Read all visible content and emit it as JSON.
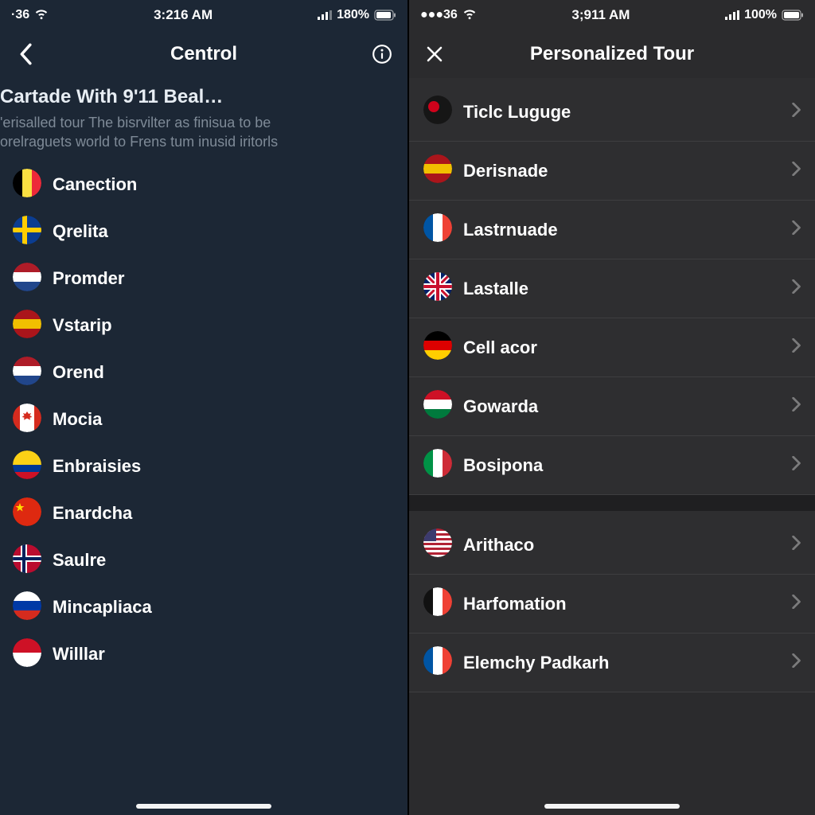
{
  "left": {
    "status": {
      "carrier": "·36",
      "time": "3:216 AM",
      "battery": "180%"
    },
    "title": "Centrol",
    "hero": {
      "heading": "Cartade With 9'11 Beal…",
      "sub1": "'erisalled tour The bisrvilter as finisua to be",
      "sub2": "orelraguets world to Frens tum inusid iritorls"
    },
    "items": [
      {
        "label": "Canection",
        "flag": "belgium"
      },
      {
        "label": "Qrelita",
        "flag": "sweden-ish"
      },
      {
        "label": "Promder",
        "flag": "netherlands"
      },
      {
        "label": "Vstarip",
        "flag": "spain"
      },
      {
        "label": "Orend",
        "flag": "netherlands"
      },
      {
        "label": "Mocia",
        "flag": "canada"
      },
      {
        "label": "Enbraisies",
        "flag": "colombia"
      },
      {
        "label": "Enardcha",
        "flag": "china"
      },
      {
        "label": "Saulre",
        "flag": "norway"
      },
      {
        "label": "Mincapliaca",
        "flag": "russia"
      },
      {
        "label": "Willlar",
        "flag": "indonesia"
      }
    ]
  },
  "right": {
    "status": {
      "carrier": "●●●36",
      "time": "3;911 AM",
      "battery": "100%"
    },
    "title": "Personalized Tour",
    "groups": [
      [
        {
          "label": "Ticlc Luguge",
          "flag": "red-dot"
        },
        {
          "label": "Derisnade",
          "flag": "spain"
        },
        {
          "label": "Lastrnuade",
          "flag": "france"
        },
        {
          "label": "Lastalle",
          "flag": "uk"
        },
        {
          "label": "Cell acor",
          "flag": "germany"
        },
        {
          "label": "Gowarda",
          "flag": "red-white-green-h"
        },
        {
          "label": "Bosipona",
          "flag": "italy"
        }
      ],
      [
        {
          "label": "Arithaco",
          "flag": "usa"
        },
        {
          "label": "Harfomation",
          "flag": "france-alt"
        },
        {
          "label": "Elemchy Padkarh",
          "flag": "france"
        }
      ]
    ]
  }
}
